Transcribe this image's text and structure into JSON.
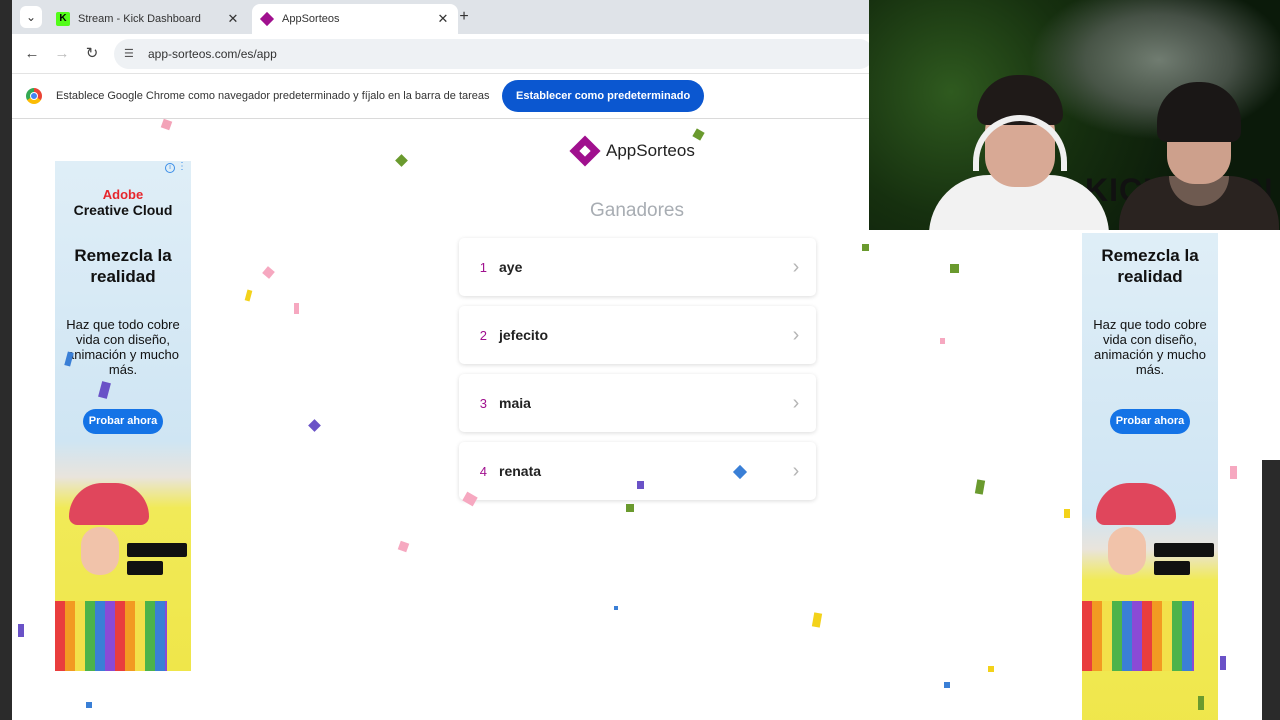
{
  "browser": {
    "tabs": [
      {
        "title": "Stream - Kick Dashboard",
        "favicon": "kick-favicon"
      },
      {
        "title": "AppSorteos",
        "favicon": "appsorteos-favicon",
        "active": true
      }
    ],
    "url": "app-sorteos.com/es/app",
    "infobar": {
      "message": "Establece Google Chrome como navegador predeterminado y fíjalo en la barra de tareas",
      "button": "Establecer como predeterminado"
    }
  },
  "app": {
    "brand": "AppSorteos",
    "heading": "Ganadores",
    "winners": [
      {
        "rank": "1",
        "name": "aye"
      },
      {
        "rank": "2",
        "name": "jefecito"
      },
      {
        "rank": "3",
        "name": "maia"
      },
      {
        "rank": "4",
        "name": "renata"
      }
    ],
    "accent_color": "#a0108e"
  },
  "ads": {
    "left": {
      "brand_line1": "Adobe",
      "brand_line2": "Creative Cloud",
      "headline": "Remezcla la realidad",
      "body": "Haz que todo cobre vida con diseño, animación y mucho más.",
      "cta": "Probar ahora"
    },
    "right": {
      "headline": "Remezcla la realidad",
      "body": "Haz que todo cobre vida con diseño, animación y mucho más.",
      "cta": "Probar ahora"
    }
  },
  "webcam": {
    "background_text": "KICKBOXIN"
  }
}
